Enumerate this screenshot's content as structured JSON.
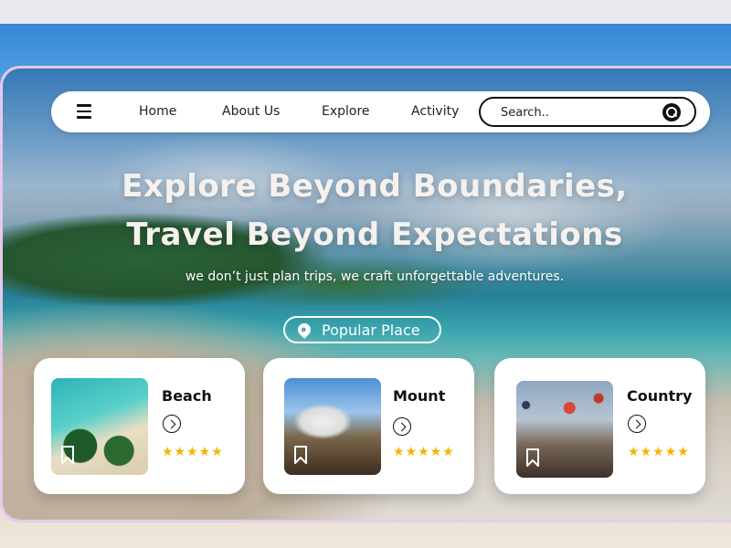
{
  "nav": {
    "menu_icon": "hamburger-menu-icon",
    "links": [
      "Home",
      "About Us",
      "Explore",
      "Activity"
    ],
    "search": {
      "placeholder": "Search..",
      "icon": "search-icon"
    }
  },
  "hero": {
    "title_line1": "Explore Beyond Boundaries,",
    "title_line2": "Travel Beyond Expectations",
    "subtitle": "we don’t just plan trips, we craft unforgettable adventures."
  },
  "popular": {
    "label": "Popular Place",
    "icon": "location-pin-icon"
  },
  "cards": [
    {
      "title": "Beach",
      "stars": "★★★★★",
      "rating": 5,
      "icon": "bookmark-icon"
    },
    {
      "title": "Mount",
      "stars": "★★★★★",
      "rating": 5,
      "icon": "bookmark-icon"
    },
    {
      "title": "Country",
      "stars": "★★★★★",
      "rating": 5,
      "icon": "bookmark-icon"
    }
  ],
  "colors": {
    "star": "#f4b400",
    "frame_border": "#e5c9ee",
    "text_dark": "#111111"
  }
}
